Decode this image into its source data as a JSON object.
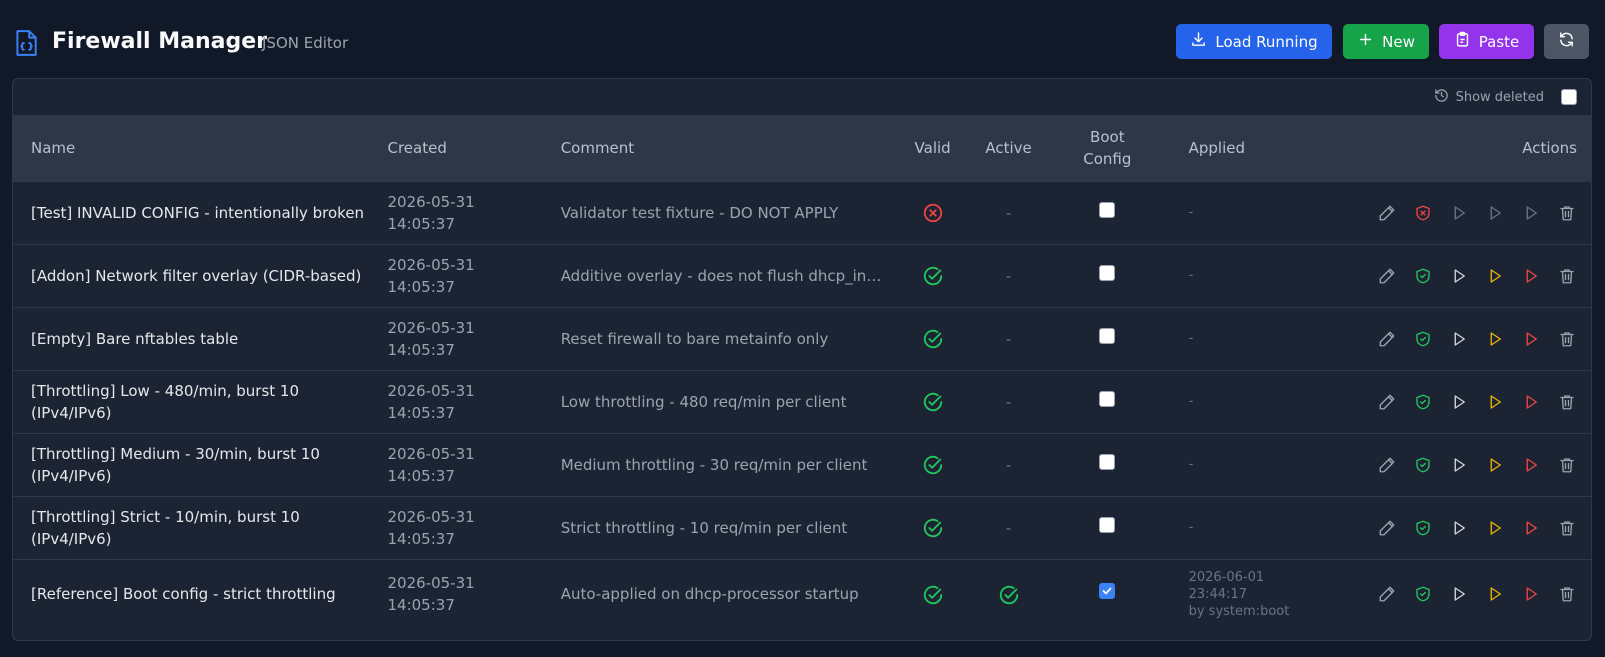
{
  "header": {
    "title": "Firewall Manager",
    "subtitle": "JSON Editor",
    "buttons": {
      "load_running": "Load Running",
      "new": "New",
      "paste": "Paste"
    }
  },
  "toolbar": {
    "show_deleted_label": "Show deleted",
    "show_deleted_checked": false
  },
  "columns": {
    "name": "Name",
    "created": "Created",
    "comment": "Comment",
    "valid": "Valid",
    "active": "Active",
    "boot_config_line1": "Boot",
    "boot_config_line2": "Config",
    "applied": "Applied",
    "actions": "Actions"
  },
  "rows": [
    {
      "name": "[Test] INVALID CONFIG - intentionally broken",
      "created_date": "2026-05-31",
      "created_time": "14:05:37",
      "comment": "Validator test fixture - DO NOT APPLY",
      "valid": false,
      "active": "-",
      "boot_config": false,
      "applied": "-"
    },
    {
      "name": "[Addon] Network filter overlay (CIDR-based)",
      "created_date": "2026-05-31",
      "created_time": "14:05:37",
      "comment": "Additive overlay - does not flush dhcp_ins...",
      "valid": true,
      "active": "-",
      "boot_config": false,
      "applied": "-"
    },
    {
      "name": "[Empty] Bare nftables table",
      "created_date": "2026-05-31",
      "created_time": "14:05:37",
      "comment": "Reset firewall to bare metainfo only",
      "valid": true,
      "active": "-",
      "boot_config": false,
      "applied": "-"
    },
    {
      "name": "[Throttling] Low - 480/min, burst 10 (IPv4/IPv6)",
      "created_date": "2026-05-31",
      "created_time": "14:05:37",
      "comment": "Low throttling - 480 req/min per client",
      "valid": true,
      "active": "-",
      "boot_config": false,
      "applied": "-"
    },
    {
      "name": "[Throttling] Medium - 30/min, burst 10 (IPv4/IPv6)",
      "created_date": "2026-05-31",
      "created_time": "14:05:37",
      "comment": "Medium throttling - 30 req/min per client",
      "valid": true,
      "active": "-",
      "boot_config": false,
      "applied": "-"
    },
    {
      "name": "[Throttling] Strict - 10/min, burst 10 (IPv4/IPv6)",
      "created_date": "2026-05-31",
      "created_time": "14:05:37",
      "comment": "Strict throttling - 10 req/min per client",
      "valid": true,
      "active": "-",
      "boot_config": false,
      "applied": "-"
    },
    {
      "name": "[Reference] Boot config - strict throttling",
      "created_date": "2026-05-31",
      "created_time": "14:05:37",
      "comment": "Auto-applied on dhcp-processor startup",
      "valid": true,
      "active": "check",
      "boot_config": true,
      "applied_date": "2026-06-01",
      "applied_time": "23:44:17",
      "applied_by": "by system:boot"
    }
  ],
  "colors": {
    "background": "#111827",
    "panel": "#1c2433",
    "header_row": "#2d3748",
    "valid_green": "#22c55e",
    "invalid_red": "#ef4444",
    "apply_yellow": "#eab308",
    "apply_red": "#ef4444",
    "load_running_blue": "#2563eb",
    "new_green": "#16a34a",
    "paste_purple": "#9333ea",
    "refresh_gray": "#4b5563"
  },
  "icons": {
    "app": "file-json-icon",
    "load_running": "download-icon",
    "new": "plus-icon",
    "paste": "clipboard-icon",
    "refresh": "refresh-icon",
    "show_deleted": "history-icon",
    "row_actions": [
      "edit-pencil-icon",
      "shield-check-icon",
      "play-icon",
      "play-yellow-icon",
      "play-red-icon",
      "trash-icon"
    ]
  }
}
